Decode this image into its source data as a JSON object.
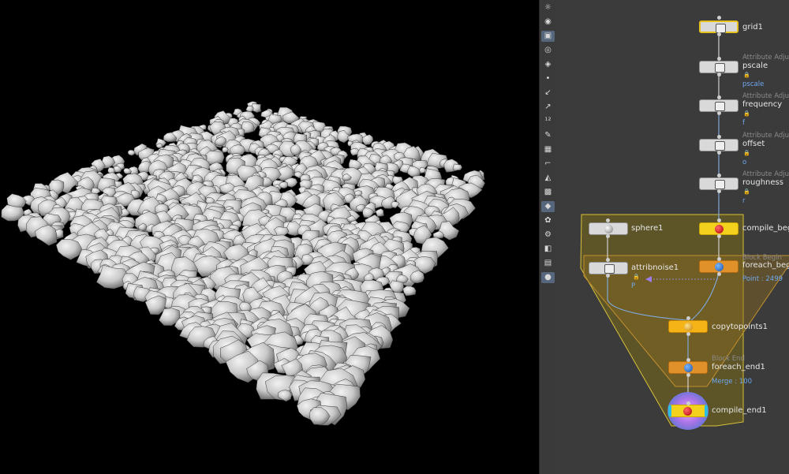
{
  "viewport": {
    "label": "3D viewport",
    "background": "#000000",
    "rock_color": "#cfcfcf"
  },
  "toolbar": {
    "tools": [
      "lightbulb-icon",
      "eye-camera-icon",
      "camera-icon",
      "view-icon",
      "snap-icon",
      "point-icon",
      "pencil-icon",
      "eyedropper-icon",
      "number-12-icon",
      "brush-icon",
      "brush-grid-icon",
      "crop-icon",
      "shape-icon",
      "checker-icon",
      "cube-icon",
      "uv-icon",
      "gear-node-icon",
      "layer-icon",
      "group-icon",
      "pin-icon"
    ],
    "active_indices": [
      2,
      14,
      19
    ]
  },
  "network": {
    "background": "#3b3b3b",
    "nodes": {
      "grid1": {
        "name": "grid1"
      },
      "pscale": {
        "type": "Attribute Adjust",
        "name": "pscale",
        "extra": "pscale"
      },
      "frequency": {
        "type": "Attribute Adjust",
        "name": "frequency",
        "extra": "f"
      },
      "offset": {
        "type": "Attribute Adjust",
        "name": "offset",
        "extra": "o"
      },
      "roughness": {
        "type": "Attribute Adjust",
        "name": "roughness",
        "extra": "r"
      },
      "sphere1": {
        "name": "sphere1"
      },
      "attribnoise1": {
        "name": "attribnoise1",
        "extra": "P"
      },
      "compile_begin": {
        "name": "compile_beg"
      },
      "foreach_begin": {
        "type": "Block Begin",
        "name": "foreach_beg",
        "extra": "Point : 2499"
      },
      "copytopoints1": {
        "name": "copytopoints1"
      },
      "foreach_end1": {
        "type": "Block End",
        "name": "foreach_end1",
        "extra": "Merge : 100"
      },
      "compile_end1": {
        "name": "compile_end1"
      }
    }
  }
}
